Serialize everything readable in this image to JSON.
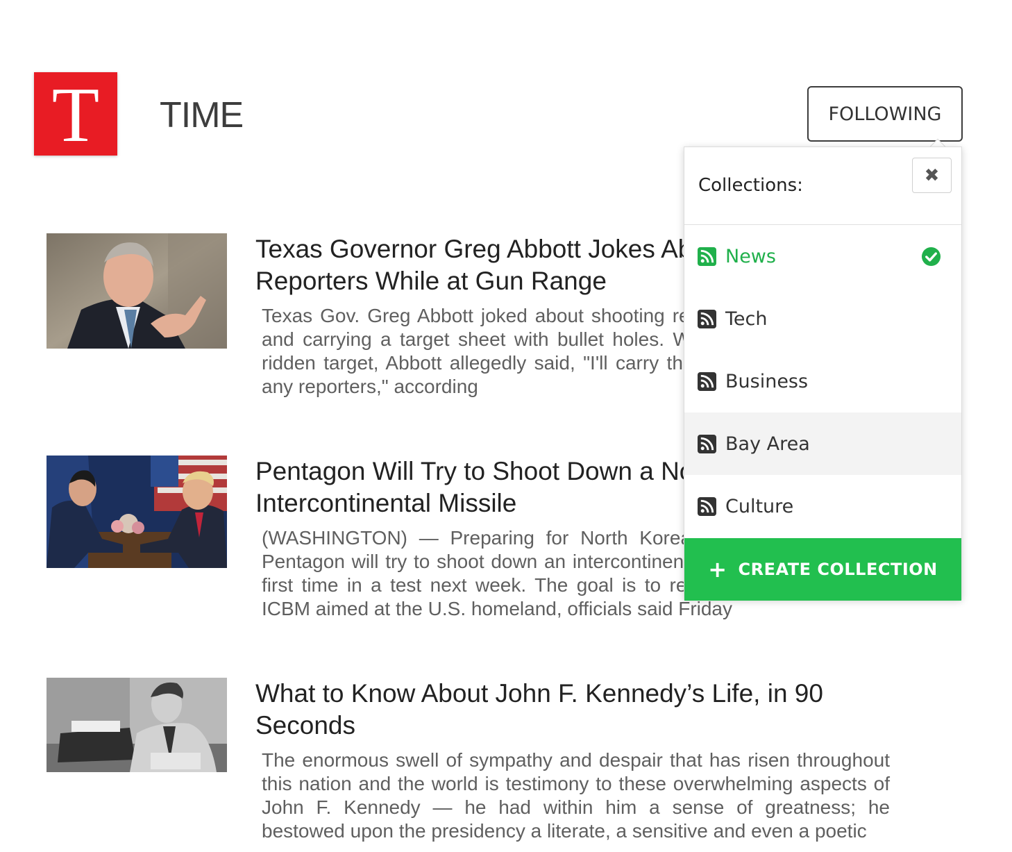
{
  "publication": {
    "logo_letter": "T",
    "title": "TIME",
    "follow_label": "FOLLOWING",
    "brand_color": "#e81c24"
  },
  "articles": [
    {
      "headline": "Texas Governor Greg Abbott Jokes About Shooting Reporters While at Gun Range",
      "summary": "Texas Gov. Greg Abbott joked about shooting reporters at a gun range and carrying a target sheet with bullet holes. While holding the bullet-ridden target, Abbott allegedly said, \"I'll carry this around in case I see any reporters,\" according",
      "image": "man-in-suit-pointing-photo"
    },
    {
      "headline": "Pentagon Will Try to Shoot Down a North Korea-Like Intercontinental Missile",
      "summary": "(WASHINGTON) — Preparing for North Korea's growing threat, the Pentagon will try to shoot down an intercontinental-range missile for the first time in a test next week. The goal is to replicate a North Korean ICBM aimed at the U.S. homeland, officials said Friday",
      "image": "leaders-handshake-photo"
    },
    {
      "headline": "What to Know About John F. Kennedy’s Life, in 90 Seconds",
      "summary": "The enormous swell of sympathy and despair that has risen throughout this nation and the world is testimony to these overwhelming aspects of John F. Kennedy — he had within him a sense of greatness; he bestowed upon the presidency a literate, a sensitive and even a poetic",
      "image": "man-at-typewriter-photo"
    }
  ],
  "collections_popover": {
    "title": "Collections:",
    "close_icon": "close-icon",
    "items": [
      {
        "label": "News",
        "icon": "rss-icon",
        "selected": true
      },
      {
        "label": "Tech",
        "icon": "rss-icon",
        "selected": false
      },
      {
        "label": "Business",
        "icon": "rss-icon",
        "selected": false
      },
      {
        "label": "Bay Area",
        "icon": "rss-icon",
        "selected": false,
        "hovered": true
      },
      {
        "label": "Culture",
        "icon": "rss-icon",
        "selected": false
      }
    ],
    "create_label": "CREATE COLLECTION",
    "accent_color": "#22bf4f",
    "selected_color": "#20b04b"
  }
}
